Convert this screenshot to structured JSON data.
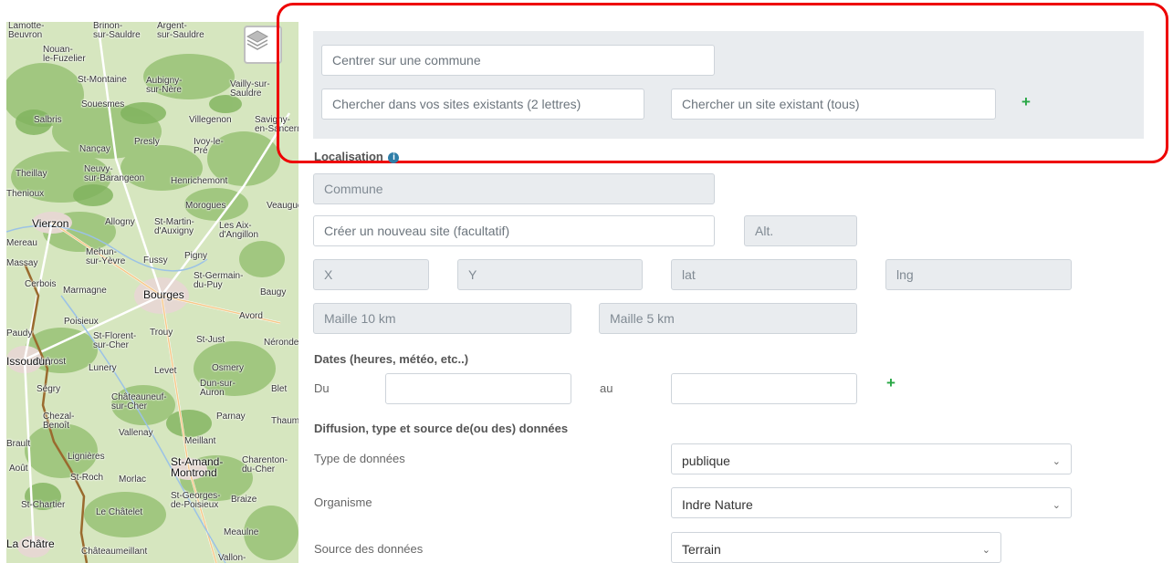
{
  "map": {
    "layers_icon": "layers-icon",
    "towns": [
      {
        "name": "Lamotte-",
        "name2": "Beuvron"
      },
      {
        "name": "Brinon-",
        "name2": "sur-Sauldre"
      },
      {
        "name": "Argent-",
        "name2": "sur-Sauldre"
      },
      {
        "name": "Nouan-",
        "name2": "le-Fuzelier"
      },
      {
        "name": "St-Montaine"
      },
      {
        "name": "Aubigny-",
        "name2": "sur-Nère"
      },
      {
        "name": "Vailly-sur-",
        "name2": "Sauldre"
      },
      {
        "name": "Souesmes"
      },
      {
        "name": "Salbris"
      },
      {
        "name": "Villegenon"
      },
      {
        "name": "Savigny-",
        "name2": "en-Sancerre"
      },
      {
        "name": "Presly"
      },
      {
        "name": "Ivoy-le-",
        "name2": "Pré"
      },
      {
        "name": "Nançay"
      },
      {
        "name": "Theillay"
      },
      {
        "name": "Neuvy-",
        "name2": "sur-Barangeon"
      },
      {
        "name": "Henrichemont"
      },
      {
        "name": "Thenioux"
      },
      {
        "name": "Morogues"
      },
      {
        "name": "Veaugues"
      },
      {
        "name": "Vierzon"
      },
      {
        "name": "Allogny"
      },
      {
        "name": "St-Martin-",
        "name2": "d'Auxigny"
      },
      {
        "name": "Les Aix-",
        "name2": "d'Angillon"
      },
      {
        "name": "Mereau"
      },
      {
        "name": "Mehun-",
        "name2": "sur-Yèvre"
      },
      {
        "name": "Pigny"
      },
      {
        "name": "Massay"
      },
      {
        "name": "Fussy"
      },
      {
        "name": "Cerbois"
      },
      {
        "name": "Marmagne"
      },
      {
        "name": "Bourges"
      },
      {
        "name": "St-Germain-",
        "name2": "du-Puy"
      },
      {
        "name": "Baugy"
      },
      {
        "name": "Poisieux"
      },
      {
        "name": "Avord"
      },
      {
        "name": "Paudy"
      },
      {
        "name": "Chârost"
      },
      {
        "name": "St-Florent-",
        "name2": "sur-Cher"
      },
      {
        "name": "Trouy"
      },
      {
        "name": "St-Just"
      },
      {
        "name": "Nérondes"
      },
      {
        "name": "Issoudun"
      },
      {
        "name": "Lunery"
      },
      {
        "name": "Levet"
      },
      {
        "name": "Osmery"
      },
      {
        "name": "Ségry"
      },
      {
        "name": "Dun-sur-",
        "name2": "Auron"
      },
      {
        "name": "Blet"
      },
      {
        "name": "Châteauneuf-",
        "name2": "sur-Cher"
      },
      {
        "name": "Chezal-",
        "name2": "Benoît"
      },
      {
        "name": "Parnay"
      },
      {
        "name": "Thaumiers"
      },
      {
        "name": "Vallenay"
      },
      {
        "name": "Meillant"
      },
      {
        "name": "Brault"
      },
      {
        "name": "Lignières"
      },
      {
        "name": "St-Amand-",
        "name2": "Montrond"
      },
      {
        "name": "Charenton-",
        "name2": "du-Cher"
      },
      {
        "name": "Août"
      },
      {
        "name": "St-Roch"
      },
      {
        "name": "Morlac"
      },
      {
        "name": "St-Chartier"
      },
      {
        "name": "Le Châtelet"
      },
      {
        "name": "St-Georges-",
        "name2": "de-Poisieux"
      },
      {
        "name": "Braize"
      },
      {
        "name": "Meaulne"
      },
      {
        "name": "La Châtre"
      },
      {
        "name": "Châteaumeillant"
      },
      {
        "name": "Vallon-"
      }
    ]
  },
  "search": {
    "commune_placeholder": "Centrer sur une commune",
    "my_sites_placeholder": "Chercher dans vos sites existants (2 lettres)",
    "all_sites_placeholder": "Chercher un site existant (tous)",
    "add_label": "+"
  },
  "localisation": {
    "title": "Localisation",
    "info_icon": "info-circle-icon",
    "commune_placeholder": "Commune",
    "new_site_placeholder": "Créer un nouveau site (facultatif)",
    "alt_placeholder": "Alt.",
    "x_placeholder": "X",
    "y_placeholder": "Y",
    "lat_placeholder": "lat",
    "lng_placeholder": "lng",
    "maille10_placeholder": "Maille 10 km",
    "maille5_placeholder": "Maille 5 km"
  },
  "dates": {
    "title": "Dates (heures, météo, etc..)",
    "from_label": "Du",
    "to_label": "au",
    "add_label": "+"
  },
  "diffusion": {
    "title": "Diffusion, type et source de(ou des) données",
    "type_label": "Type de données",
    "type_value": "publique",
    "org_label": "Organisme",
    "org_value": "Indre Nature",
    "source_label": "Source des données",
    "source_value": "Terrain"
  },
  "colors": {
    "highlight": "#ee0000",
    "add_green": "#28a745",
    "panel_gray": "#e9ecef"
  }
}
